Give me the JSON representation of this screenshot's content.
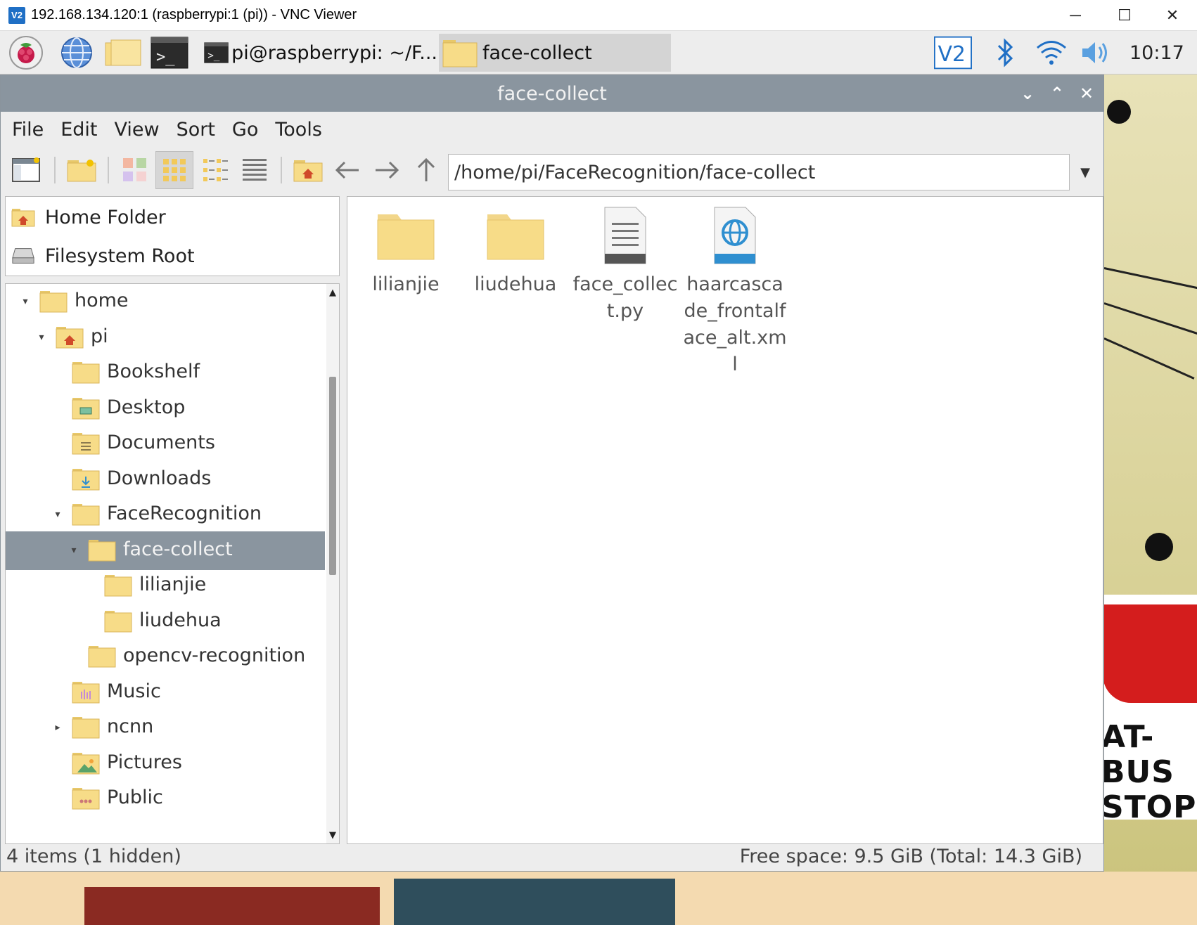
{
  "vnc": {
    "title": "192.168.134.120:1 (raspberrypi:1 (pi)) - VNC Viewer",
    "logo": "V2",
    "controls": {
      "minimize": "─",
      "maximize": "☐",
      "close": "✕"
    }
  },
  "taskbar": {
    "terminal_task": "pi@raspberrypi: ~/F...",
    "folder_task": "face-collect",
    "clock": "10:17",
    "tray_vnc_label": "V2"
  },
  "window": {
    "title": "face-collect",
    "controls": {
      "minimize": "⌄",
      "maximize": "⌃",
      "close": "✕"
    }
  },
  "menu": {
    "file": "File",
    "edit": "Edit",
    "view": "View",
    "sort": "Sort",
    "go": "Go",
    "tools": "Tools"
  },
  "path": "/home/pi/FaceRecognition/face-collect",
  "places": [
    {
      "label": "Home Folder",
      "icon": "home-icon"
    },
    {
      "label": "Filesystem Root",
      "icon": "drive-icon"
    }
  ],
  "tree": [
    {
      "label": "home",
      "expander": "▾",
      "kind": "folder"
    },
    {
      "label": "pi",
      "expander": "▾",
      "kind": "home"
    },
    {
      "label": "Bookshelf",
      "expander": "",
      "kind": "folder"
    },
    {
      "label": "Desktop",
      "expander": "",
      "kind": "desktop"
    },
    {
      "label": "Documents",
      "expander": "",
      "kind": "documents"
    },
    {
      "label": "Downloads",
      "expander": "",
      "kind": "downloads"
    },
    {
      "label": "FaceRecognition",
      "expander": "▾",
      "kind": "folder"
    },
    {
      "label": "face-collect",
      "expander": "▾",
      "kind": "folder"
    },
    {
      "label": "lilianjie",
      "expander": "",
      "kind": "folder"
    },
    {
      "label": "liudehua",
      "expander": "",
      "kind": "folder"
    },
    {
      "label": "opencv-recognition",
      "expander": "",
      "kind": "folder"
    },
    {
      "label": "Music",
      "expander": "",
      "kind": "music"
    },
    {
      "label": "ncnn",
      "expander": "▸",
      "kind": "folder"
    },
    {
      "label": "Pictures",
      "expander": "",
      "kind": "pictures"
    },
    {
      "label": "Public",
      "expander": "",
      "kind": "public"
    }
  ],
  "files": [
    {
      "name": "lilianjie",
      "type": "folder"
    },
    {
      "name": "liudehua",
      "type": "folder"
    },
    {
      "name": "face_collect.py",
      "type": "text"
    },
    {
      "name": "haarcascade_frontalface_alt.xml",
      "type": "xml"
    }
  ],
  "status": {
    "left": "4 items (1 hidden)",
    "right": "Free space: 9.5 GiB (Total: 14.3 GiB)"
  },
  "wallpaper": {
    "sign_line1": "AT-BUS",
    "sign_line2": "STOP"
  },
  "colors": {
    "selection": "#8a959f",
    "folder": "#f7dc88",
    "accent_blue": "#1f6fc5"
  }
}
